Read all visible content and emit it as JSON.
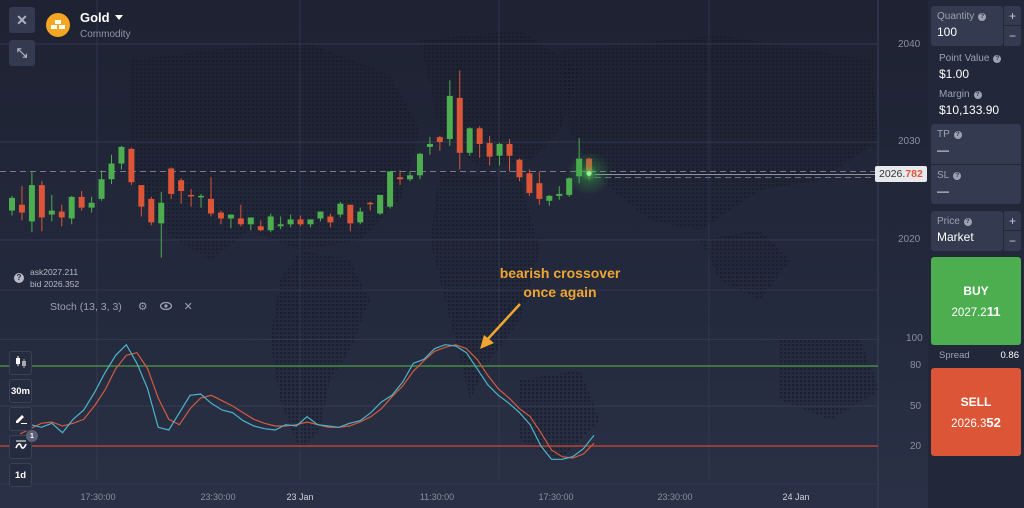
{
  "window_controls": {
    "close_icon": "✕",
    "collapse_icon": "⤡"
  },
  "asset": {
    "name": "Gold",
    "category": "Commodity",
    "icon": "gold-bars-icon"
  },
  "quotes": {
    "ask": "ask2027.211",
    "bid": "bid 2026.352"
  },
  "indicator": {
    "label": "Stoch (13, 3, 3)",
    "settings_icon": "⚙",
    "visibility_icon": "👁",
    "remove_icon": "✕"
  },
  "left_toolbar": {
    "chart_type_icon": "candlestick-icon",
    "timeframe": "30m",
    "draw_icon": "pencil-icon",
    "indicators_icon": "indicators-icon",
    "indicators_badge": "1",
    "period": "1d"
  },
  "price_axis": {
    "ticks": [
      "2040",
      "2030",
      "2020"
    ],
    "current_price_main": "2026.",
    "current_price_highlight": "782"
  },
  "stoch_axis": {
    "ticks": [
      "100",
      "80",
      "50",
      "20"
    ]
  },
  "time_axis": [
    {
      "label": "17:30:00",
      "bold": false
    },
    {
      "label": "23:30:00",
      "bold": false
    },
    {
      "label": "23 Jan",
      "bold": true
    },
    {
      "label": "11:30:00",
      "bold": false
    },
    {
      "label": "17:30:00",
      "bold": false
    },
    {
      "label": "23:30:00",
      "bold": false
    },
    {
      "label": "24 Jan",
      "bold": true
    }
  ],
  "annotation": {
    "line1": "bearish crossover",
    "line2": "once again",
    "color": "#f0a630"
  },
  "order_panel": {
    "quantity_label": "Quantity",
    "quantity_value": "100",
    "plus": "+",
    "minus": "−",
    "point_value_label": "Point Value",
    "point_value": "$1.00",
    "margin_label": "Margin",
    "margin_value": "$10,133.90",
    "tp_label": "TP",
    "tp_value": "—",
    "sl_label": "SL",
    "sl_value": "—",
    "price_label": "Price",
    "price_value": "Market",
    "buy_label": "BUY",
    "buy_price_main": "2027.2",
    "buy_price_bold": "11",
    "spread_label": "Spread",
    "spread_value": "0.86",
    "sell_label": "SELL",
    "sell_price_main": "2026.3",
    "sell_price_bold": "52"
  },
  "colors": {
    "bull": "#4cae4f",
    "bear": "#dc5536",
    "k_line": "#4fb3c8",
    "d_line": "#d45a3e",
    "overbought": "#4a8a45",
    "oversold": "#b8443a"
  },
  "chart_data": {
    "type": "candlestick",
    "title": "Gold",
    "price_range": [
      2016.5,
      2043
    ],
    "price_ticks": [
      2020,
      2030,
      2040
    ],
    "current_price": 2026.782,
    "candles": [
      {
        "o": 2023.0,
        "h": 2024.5,
        "c": 2024.3,
        "l": 2022.5
      },
      {
        "o": 2023.6,
        "h": 2025.5,
        "c": 2022.8,
        "l": 2022.0
      },
      {
        "o": 2021.9,
        "h": 2027.0,
        "c": 2025.6,
        "l": 2020.8
      },
      {
        "o": 2025.6,
        "h": 2026.0,
        "c": 2022.3,
        "l": 2020.9
      },
      {
        "o": 2022.6,
        "h": 2024.6,
        "c": 2023.0,
        "l": 2021.9
      },
      {
        "o": 2022.9,
        "h": 2023.6,
        "c": 2022.3,
        "l": 2021.4
      },
      {
        "o": 2022.2,
        "h": 2024.5,
        "c": 2024.4,
        "l": 2021.6
      },
      {
        "o": 2024.4,
        "h": 2025.0,
        "c": 2023.3,
        "l": 2023.0
      },
      {
        "o": 2023.3,
        "h": 2024.4,
        "c": 2023.8,
        "l": 2022.8
      },
      {
        "o": 2024.2,
        "h": 2027.1,
        "c": 2026.2,
        "l": 2024.0
      },
      {
        "o": 2026.2,
        "h": 2028.7,
        "c": 2027.8,
        "l": 2025.7
      },
      {
        "o": 2027.8,
        "h": 2029.6,
        "c": 2029.5,
        "l": 2027.2
      },
      {
        "o": 2029.3,
        "h": 2029.4,
        "c": 2025.9,
        "l": 2025.6
      },
      {
        "o": 2025.6,
        "h": 2025.6,
        "c": 2023.4,
        "l": 2022.4
      },
      {
        "o": 2024.2,
        "h": 2024.4,
        "c": 2021.8,
        "l": 2021.5
      },
      {
        "o": 2021.7,
        "h": 2024.9,
        "c": 2023.8,
        "l": 2018.2
      },
      {
        "o": 2027.3,
        "h": 2027.4,
        "c": 2024.7,
        "l": 2024.2
      },
      {
        "o": 2026.1,
        "h": 2026.3,
        "c": 2025.0,
        "l": 2023.7
      },
      {
        "o": 2024.6,
        "h": 2025.2,
        "c": 2024.5,
        "l": 2023.4
      },
      {
        "o": 2024.5,
        "h": 2024.7,
        "c": 2024.5,
        "l": 2023.3
      },
      {
        "o": 2024.2,
        "h": 2026.4,
        "c": 2022.7,
        "l": 2022.4
      },
      {
        "o": 2022.8,
        "h": 2023.0,
        "c": 2022.2,
        "l": 2021.6
      },
      {
        "o": 2022.2,
        "h": 2022.6,
        "c": 2022.6,
        "l": 2021.2
      },
      {
        "o": 2022.2,
        "h": 2023.6,
        "c": 2021.6,
        "l": 2021.4
      },
      {
        "o": 2021.6,
        "h": 2022.2,
        "c": 2022.3,
        "l": 2021.0
      },
      {
        "o": 2021.4,
        "h": 2022.0,
        "c": 2021.0,
        "l": 2020.9
      },
      {
        "o": 2021.0,
        "h": 2022.7,
        "c": 2022.4,
        "l": 2020.8
      },
      {
        "o": 2021.4,
        "h": 2022.4,
        "c": 2021.6,
        "l": 2021.1
      },
      {
        "o": 2021.6,
        "h": 2022.6,
        "c": 2022.1,
        "l": 2021.3
      },
      {
        "o": 2022.1,
        "h": 2022.5,
        "c": 2021.6,
        "l": 2021.4
      },
      {
        "o": 2021.6,
        "h": 2022.1,
        "c": 2022.1,
        "l": 2021.3
      },
      {
        "o": 2022.2,
        "h": 2022.9,
        "c": 2022.9,
        "l": 2021.9
      },
      {
        "o": 2022.4,
        "h": 2022.7,
        "c": 2021.8,
        "l": 2021.3
      },
      {
        "o": 2022.6,
        "h": 2023.9,
        "c": 2023.7,
        "l": 2022.3
      },
      {
        "o": 2023.6,
        "h": 2023.6,
        "c": 2021.7,
        "l": 2020.9
      },
      {
        "o": 2021.8,
        "h": 2023.3,
        "c": 2022.9,
        "l": 2021.6
      },
      {
        "o": 2023.8,
        "h": 2023.9,
        "c": 2023.7,
        "l": 2023.0
      },
      {
        "o": 2022.7,
        "h": 2024.5,
        "c": 2024.6,
        "l": 2022.6
      },
      {
        "o": 2023.4,
        "h": 2025.5,
        "c": 2027.0,
        "l": 2023.2
      },
      {
        "o": 2026.4,
        "h": 2027.1,
        "c": 2026.2,
        "l": 2025.6
      },
      {
        "o": 2026.2,
        "h": 2027.0,
        "c": 2026.6,
        "l": 2026.0
      },
      {
        "o": 2026.6,
        "h": 2028.9,
        "c": 2028.8,
        "l": 2026.2
      },
      {
        "o": 2029.5,
        "h": 2030.5,
        "c": 2029.8,
        "l": 2028.7
      },
      {
        "o": 2030.5,
        "h": 2030.6,
        "c": 2030.0,
        "l": 2029.1
      },
      {
        "o": 2030.3,
        "h": 2036.3,
        "c": 2034.7,
        "l": 2029.6
      },
      {
        "o": 2034.5,
        "h": 2037.3,
        "c": 2028.9,
        "l": 2027.2
      },
      {
        "o": 2028.9,
        "h": 2031.5,
        "c": 2031.4,
        "l": 2028.6
      },
      {
        "o": 2031.4,
        "h": 2031.6,
        "c": 2029.8,
        "l": 2028.4
      },
      {
        "o": 2029.9,
        "h": 2030.6,
        "c": 2028.5,
        "l": 2027.6
      },
      {
        "o": 2028.6,
        "h": 2029.9,
        "c": 2029.8,
        "l": 2027.6
      },
      {
        "o": 2029.8,
        "h": 2030.3,
        "c": 2028.6,
        "l": 2027.0
      },
      {
        "o": 2028.2,
        "h": 2028.3,
        "c": 2026.4,
        "l": 2026.0
      },
      {
        "o": 2026.8,
        "h": 2027.2,
        "c": 2024.8,
        "l": 2024.5
      },
      {
        "o": 2025.8,
        "h": 2027.0,
        "c": 2024.2,
        "l": 2023.6
      },
      {
        "o": 2024.0,
        "h": 2024.6,
        "c": 2024.5,
        "l": 2023.5
      },
      {
        "o": 2024.5,
        "h": 2025.5,
        "c": 2024.7,
        "l": 2024.1
      },
      {
        "o": 2024.6,
        "h": 2026.4,
        "c": 2026.3,
        "l": 2024.4
      },
      {
        "o": 2026.5,
        "h": 2030.4,
        "c": 2028.3,
        "l": 2025.8
      },
      {
        "o": 2028.3,
        "h": 2028.4,
        "c": 2026.8,
        "l": 2026.2
      }
    ],
    "stochastic": {
      "label": "Stoch (13, 3, 3)",
      "range": [
        0,
        100
      ],
      "ticks": [
        100,
        80,
        50,
        20
      ],
      "overbought": 80,
      "oversold": 20,
      "k": [
        35,
        36,
        34,
        37,
        30,
        40,
        47,
        60,
        75,
        88,
        96,
        82,
        63,
        34,
        32,
        45,
        58,
        59,
        52,
        47,
        45,
        39,
        35,
        33,
        32,
        36,
        35,
        42,
        36,
        35,
        34,
        37,
        39,
        45,
        53,
        58,
        68,
        82,
        85,
        93,
        96,
        95,
        90,
        78,
        66,
        58,
        52,
        45,
        36,
        20,
        10,
        10,
        12,
        18,
        28
      ],
      "d": [
        29,
        33,
        37,
        38,
        35,
        37,
        40,
        50,
        62,
        78,
        88,
        90,
        78,
        56,
        40,
        36,
        48,
        56,
        58,
        54,
        50,
        45,
        40,
        37,
        35,
        35,
        36,
        38,
        36,
        34,
        34,
        35,
        38,
        42,
        48,
        57,
        65,
        76,
        84,
        91,
        94,
        96,
        93,
        85,
        73,
        63,
        56,
        48,
        42,
        30,
        17,
        12,
        11,
        14,
        22
      ]
    },
    "time_ticks": [
      "17:30:00",
      "23:30:00",
      "23 Jan",
      "11:30:00",
      "17:30:00",
      "23:30:00",
      "24 Jan"
    ]
  }
}
